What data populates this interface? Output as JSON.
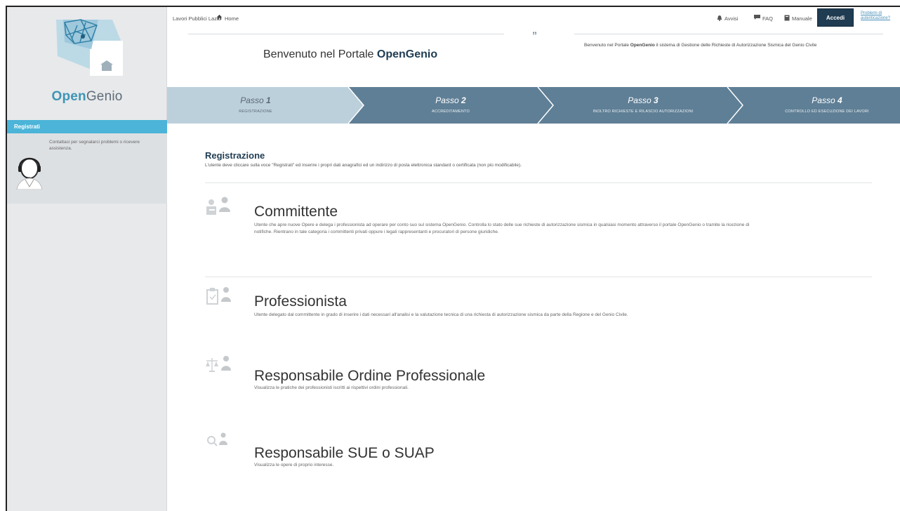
{
  "brand": {
    "name_bold": "Open",
    "name_rest": "Genio"
  },
  "sidebar": {
    "register_tab": "Registrati",
    "support_text": "Contattaci per segnalarci problemi o ricevere assistenza."
  },
  "topbar": {
    "crumb_site": "Lavori Pubblici Lazio",
    "crumb_home": "Home",
    "links": {
      "alerts": "Avvisi",
      "faq": "FAQ",
      "manual": "Manuale"
    },
    "login_label": "Accedi",
    "auth_problem_label": "Problemi di autenticazione?"
  },
  "welcome": {
    "title_prefix": "Benvenuto nel Portale ",
    "title_bold": "OpenGenio",
    "quote": "”",
    "desc_prefix": "Benvenuto nel Portale ",
    "desc_bold": "OpenGenio",
    "desc_rest": " il sistema di Gestione delle Richieste di Autorizzazione Sismica del Genio Civile"
  },
  "steps": [
    {
      "word": "Passo",
      "num": "1",
      "sub": "REGISTRAZIONE"
    },
    {
      "word": "Passo",
      "num": "2",
      "sub": "ACCREDITAMENTO"
    },
    {
      "word": "Passo",
      "num": "3",
      "sub": "INOLTRO RICHIESTE E RILASCIO AUTORIZZAZIONI"
    },
    {
      "word": "Passo",
      "num": "4",
      "sub": "CONTROLLO ED ESECUZIONE DEI LAVORI"
    }
  ],
  "colors": {
    "accent": "#4bb4d8",
    "step_active": "#bcd0dc",
    "step_inactive": "#5f7f96",
    "dark": "#1f3c52"
  },
  "registration": {
    "heading": "Registrazione",
    "desc": "L'utente deve cliccare sulla voce \"Registrati\" ed inserire i propri dati anagrafici ed un indirizzo di posta elettronica standard o certificata (non più modificabile).",
    "roles": [
      {
        "icon": "client-users-icon",
        "title": "Committente",
        "desc": "Utente che apre nuove Opere e delega i professionista ad operare per conto suo sul sistema OpenGenio. Controlla lo stato delle sue richieste di autorizzazione sismica in qualsiasi momento attraverso il portale OpenGenio o tramite la ricezione di notifiche. Rientrano in tale categoria i committenti privati oppure i legali rappresentanti e procuratori di persone giuridiche."
      },
      {
        "icon": "clipboard-user-icon",
        "title": "Professionista",
        "desc": "Utente delegato dal committente in grado di inserire i dati necessari all'analisi e la valutazione tecnica di una richiesta di autorizzazione sismica da parte della Regione e del Genio Civile."
      },
      {
        "icon": "scale-user-icon",
        "title": "Responsabile Ordine Professionale",
        "desc": "Visualizza le pratiche dei professionisti iscritti ai rispettivi ordini professionali."
      },
      {
        "icon": "search-user-icon",
        "title": "Responsabile SUE o SUAP",
        "desc": "Visualizza le opere di proprio interesse."
      }
    ]
  }
}
